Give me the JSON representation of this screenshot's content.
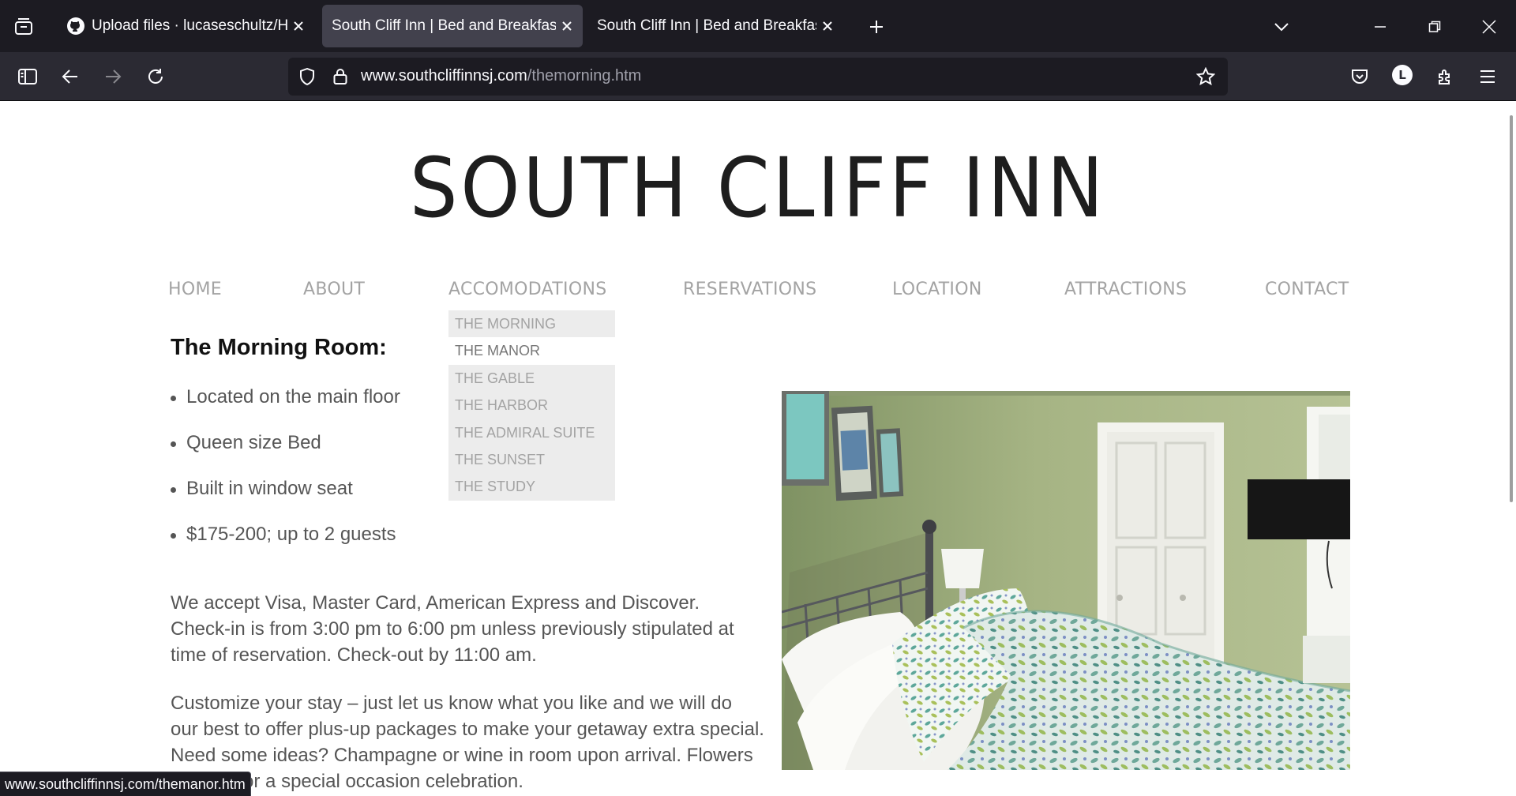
{
  "browser": {
    "tabs": [
      {
        "title": "Upload files · lucaseschultz/HTTP",
        "favicon": "github-icon",
        "active": false
      },
      {
        "title": "South Cliff Inn | Bed and Breakfast | Cape May",
        "active": true
      },
      {
        "title": "South Cliff Inn | Bed and Breakfast | Cape May",
        "active": false
      }
    ],
    "url": {
      "domain": "www.southcliffinnsj.com",
      "path": "/themorning.htm"
    },
    "profile_initial": "L",
    "status_link": "www.southcliffinnsj.com/themanor.htm"
  },
  "site": {
    "logo": "SOUTH CLIFF INN",
    "nav": [
      "HOME",
      "ABOUT",
      "ACCOMODATIONS",
      "RESERVATIONS",
      "LOCATION",
      "ATTRACTIONS",
      "CONTACT"
    ],
    "dropdown": [
      "THE MORNING",
      "THE MANOR",
      "THE GABLE",
      "THE HARBOR",
      "THE ADMIRAL SUITE",
      "THE SUNSET",
      "THE STUDY"
    ],
    "dropdown_hovered": "THE MANOR"
  },
  "room": {
    "title": "The Morning Room:",
    "features": [
      "Located on the main floor",
      "Queen size Bed",
      "Built in window seat",
      "$175-200; up to 2 guests"
    ],
    "paragraph1": "We accept Visa, Master Card, American Express and Discover. Check-in is from 3:00 pm to 6:00 pm unless previously stipulated at time of reservation. Check-out by 11:00 am.",
    "paragraph2": "Customize your stay – just let us know what you like and we will do our best to offer plus-up packages to make your getaway extra special. Need some ideas? Champagne or wine in room upon arrival. Flowers or cake for a special occasion celebration."
  },
  "colors": {
    "chrome_dark": "#1c1b22",
    "chrome_toolbar": "#2b2a33",
    "nav_text": "#a3a3a3",
    "body_text": "#555555",
    "wall_green": "#9cac7c"
  }
}
